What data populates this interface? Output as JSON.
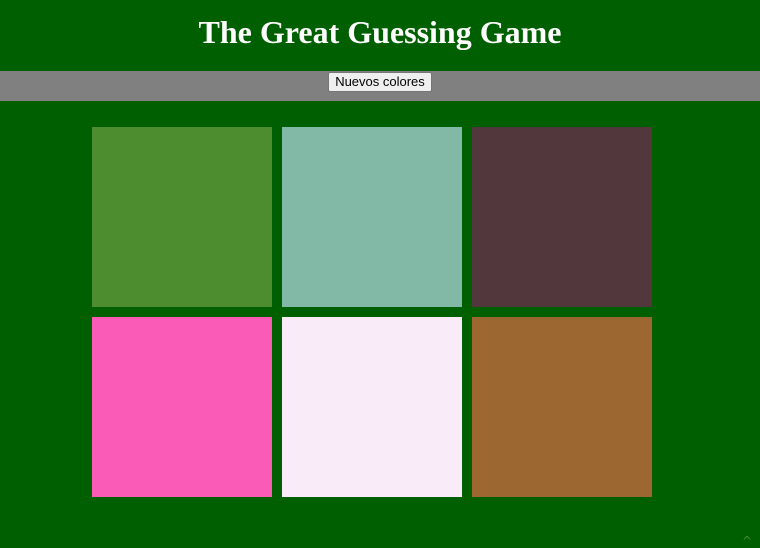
{
  "header": {
    "title": "The Great Guessing Game"
  },
  "toolbar": {
    "new_colors_label": "Nuevos colores"
  },
  "squares": [
    {
      "color": "#4d8c2f"
    },
    {
      "color": "#82b8a6"
    },
    {
      "color": "#52383d"
    },
    {
      "color": "#fa5bb6"
    },
    {
      "color": "#faebf9"
    },
    {
      "color": "#9c6731"
    }
  ],
  "colors": {
    "background": "#005f00",
    "toolbar": "#808080"
  },
  "corner": {
    "icon": "caret-up-icon"
  }
}
